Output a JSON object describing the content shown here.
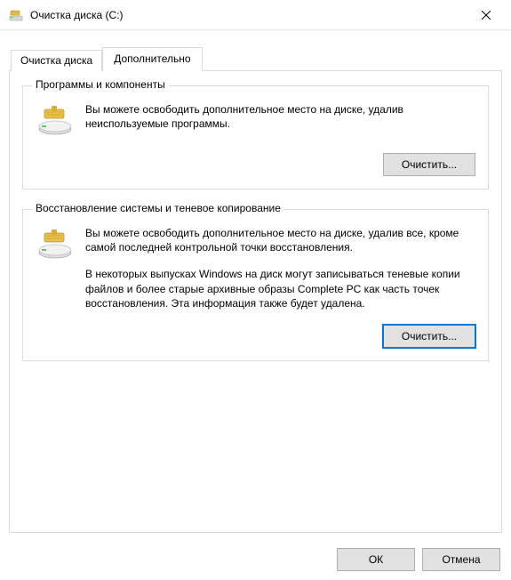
{
  "window": {
    "title": "Очистка диска  (C:)"
  },
  "tabs": {
    "cleanup": "Очистка диска",
    "more": "Дополнительно",
    "active": "more"
  },
  "groups": {
    "programs": {
      "legend": "Программы и компоненты",
      "text1": "Вы можете освободить дополнительное место на диске, удалив неиспользуемые программы.",
      "button": "Очистить..."
    },
    "restore": {
      "legend": "Восстановление системы и теневое копирование",
      "text1": "Вы можете освободить дополнительное место на диске, удалив все, кроме самой последней контрольной точки восстановления.",
      "text2": "В некоторых выпусках Windows на диск могут записываться теневые копии файлов и более старые архивные образы Complete PC как часть точек восстановления. Эта информация также будет удалена.",
      "button": "Очистить..."
    }
  },
  "footer": {
    "ok": "ОК",
    "cancel": "Отмена"
  },
  "icons": {
    "app": "disk-cleanup-icon",
    "drive": "drive-brush-icon",
    "close": "close-icon"
  }
}
